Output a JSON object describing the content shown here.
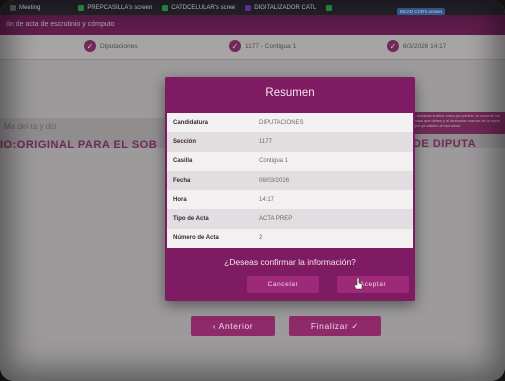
{
  "taskbar": {
    "items": [
      {
        "icon": "meeting-icon",
        "label": "Meeting",
        "color": "#6c6c6c"
      },
      {
        "icon": "screen-icon",
        "label": "PREPCASILLA's screen",
        "color": "#2fa84f"
      },
      {
        "icon": "screen-icon",
        "label": "CATDCELULAR's scree",
        "color": "#2fa84f"
      },
      {
        "icon": "screen-icon",
        "label": "DIGITALIZADOR CATL",
        "color": "#7a3fbf"
      },
      {
        "icon": "screen-icon",
        "label": "",
        "color": "#2fa84f"
      }
    ],
    "badge": "MCAD CCR's screen"
  },
  "app": {
    "header_title": "ón de acta de escrutinio y cómputo"
  },
  "steps": [
    {
      "label": "Diputaciones"
    },
    {
      "label": "1177 - Contigua 1"
    },
    {
      "label": "6/3/2026 14:17"
    }
  ],
  "background": {
    "left_text": "Ma  del-ta  y  dci",
    "original_text": "IO:ORIGINAL PARA EL SOB",
    "diput_text": "CIÓN DE DIPUTA",
    "notice_text": "...todos/as sus/los votos por partido; la suma de los votos que deben y al descontar marcas de la copia que ya validen al escrutinio."
  },
  "modal": {
    "title": "Resumen",
    "rows": [
      {
        "key": "Candidatura",
        "value": "DIPUTACIONES"
      },
      {
        "key": "Sección",
        "value": "1177"
      },
      {
        "key": "Casilla",
        "value": "Contigua 1"
      },
      {
        "key": "Fecha",
        "value": "06/03/2026"
      },
      {
        "key": "Hora",
        "value": "14:17"
      },
      {
        "key": "Tipo de Acta",
        "value": "ACTA PREP"
      },
      {
        "key": "Número de Acta",
        "value": "2"
      }
    ],
    "question": "¿Deseas confirmar la información?",
    "cancel_label": "Cancelar",
    "accept_label": "Aceptar"
  },
  "footer": {
    "prev_label": "‹ Anterior",
    "finish_label": "Finalizar ✓"
  },
  "colors": {
    "brand": "#7e1b63",
    "accent": "#9c2a78"
  }
}
